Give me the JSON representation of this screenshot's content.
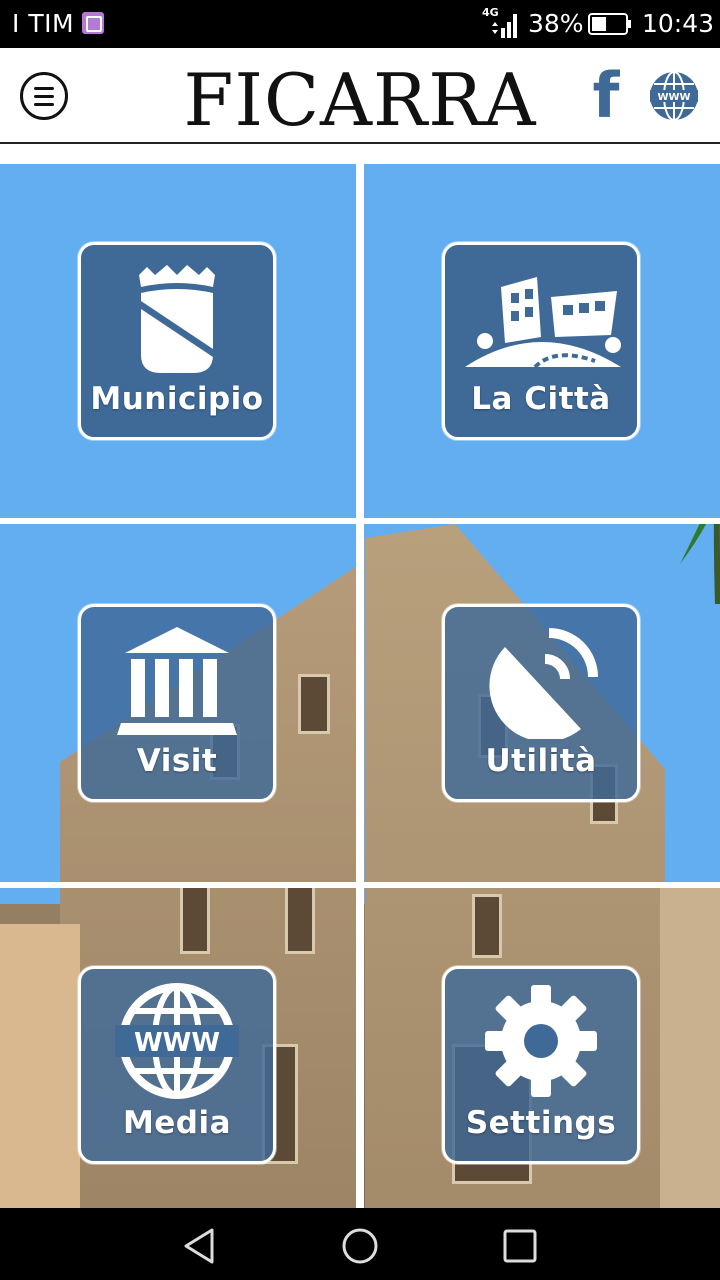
{
  "status_bar": {
    "carrier": "I TIM",
    "network": "4G",
    "battery_pct": "38%",
    "time": "10:43"
  },
  "header": {
    "title": "FICARRA",
    "menu_icon": "hamburger-menu-icon",
    "social_icon": "facebook-icon",
    "web_icon": "www-globe-icon"
  },
  "tiles": [
    {
      "label": "Municipio",
      "icon": "coat-of-arms-icon"
    },
    {
      "label": "La Città",
      "icon": "town-buildings-icon"
    },
    {
      "label": "Visit",
      "icon": "museum-icon"
    },
    {
      "label": "Utilità",
      "icon": "satellite-dish-icon"
    },
    {
      "label": "Media",
      "icon": "www-globe-icon"
    },
    {
      "label": "Settings",
      "icon": "gear-icon"
    }
  ],
  "colors": {
    "accent": "#3f6a98",
    "sky": "#63aef0",
    "header_bg": "#ffffff",
    "status_bg": "#000000"
  },
  "nav_bar": {
    "back_icon": "back-triangle-icon",
    "home_icon": "home-circle-icon",
    "recents_icon": "recents-square-icon"
  }
}
